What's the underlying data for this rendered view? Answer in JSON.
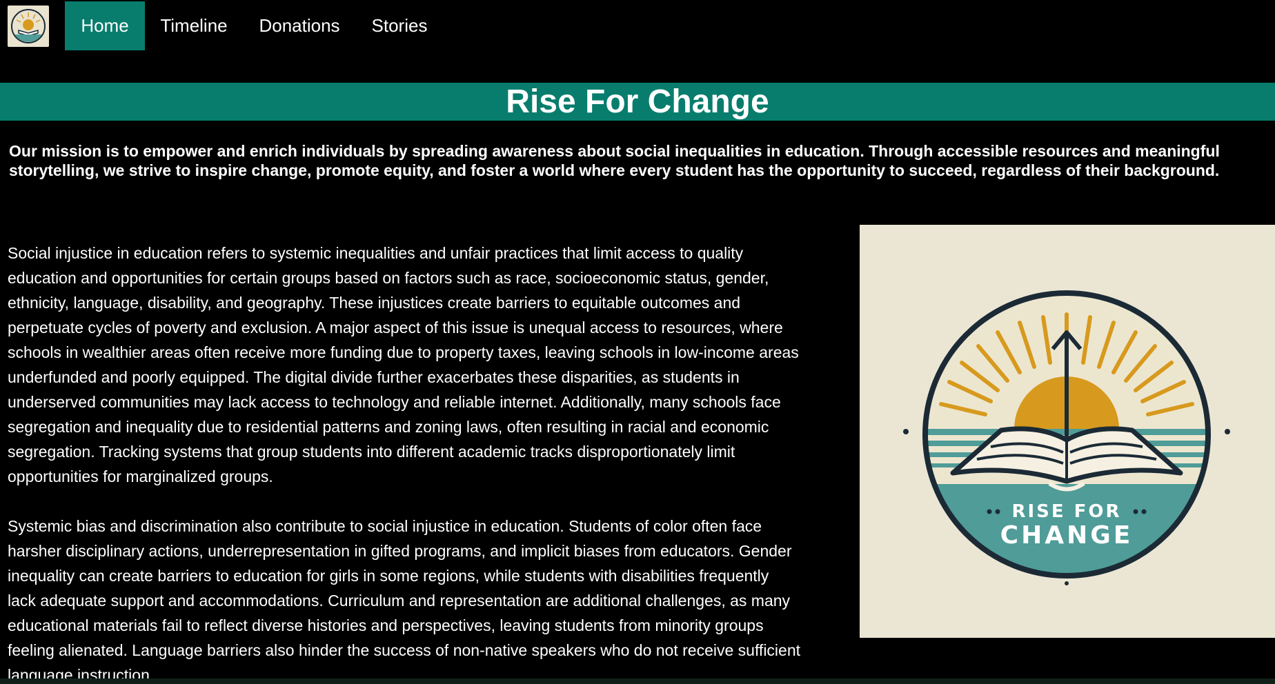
{
  "nav": {
    "logo_icon": "book-sunrise-logo-icon",
    "items": [
      {
        "label": "Home",
        "active": true
      },
      {
        "label": "Timeline",
        "active": false
      },
      {
        "label": "Donations",
        "active": false
      },
      {
        "label": "Stories",
        "active": false
      }
    ]
  },
  "banner": {
    "title": "Rise For Change"
  },
  "mission": {
    "lines": [
      "Our mission is to empower and enrich individuals by spreading awareness about social inequalities in education. Through accessible resources and meaningful",
      "storytelling, we strive to inspire change, promote equity, and foster a world where every student has the opportunity to succeed, regardless of their background."
    ]
  },
  "content": {
    "paragraph1": [
      "Social injustice in education refers to systemic inequalities and unfair practices that limit access to quality",
      "education and opportunities for certain groups based on factors such as race, socioeconomic status, gender,",
      "ethnicity, language, disability, and geography. These injustices create barriers to equitable outcomes and",
      "perpetuate cycles of poverty and exclusion. A major aspect of this issue is unequal access to resources, where",
      "schools in wealthier areas often receive more funding due to property taxes, leaving schools in low-income areas",
      "underfunded and poorly equipped. The digital divide further exacerbates these disparities, as students in",
      "underserved communities may lack access to technology and reliable internet. Additionally, many schools face",
      "segregation and inequality due to residential patterns and zoning laws, often resulting in racial and economic",
      "segregation. Tracking systems that group students into different academic tracks disproportionately limit",
      "opportunities for marginalized groups."
    ],
    "paragraph2": [
      "Systemic bias and discrimination also contribute to social injustice in education. Students of color often face",
      "harsher disciplinary actions, underrepresentation in gifted programs, and implicit biases from educators. Gender",
      "inequality can create barriers to education for girls in some regions, while students with disabilities frequently",
      "lack adequate support and accommodations. Curriculum and representation are additional challenges, as many",
      "educational materials fail to reflect diverse histories and perspectives, leaving students from minority groups",
      "feeling alienated. Language barriers also hinder the success of non-native speakers who do not receive sufficient",
      "language instruction."
    ]
  },
  "hero_image": {
    "icon": "rise-for-change-logo-icon",
    "text_line1": "RISE FOR",
    "text_line2": "CHANGE"
  },
  "colors": {
    "accent": "#087d6d",
    "background": "#000000",
    "sun": "#d79a1e",
    "teal": "#4f9c98",
    "cream": "#ebe6d4",
    "navy": "#1b2a35"
  }
}
